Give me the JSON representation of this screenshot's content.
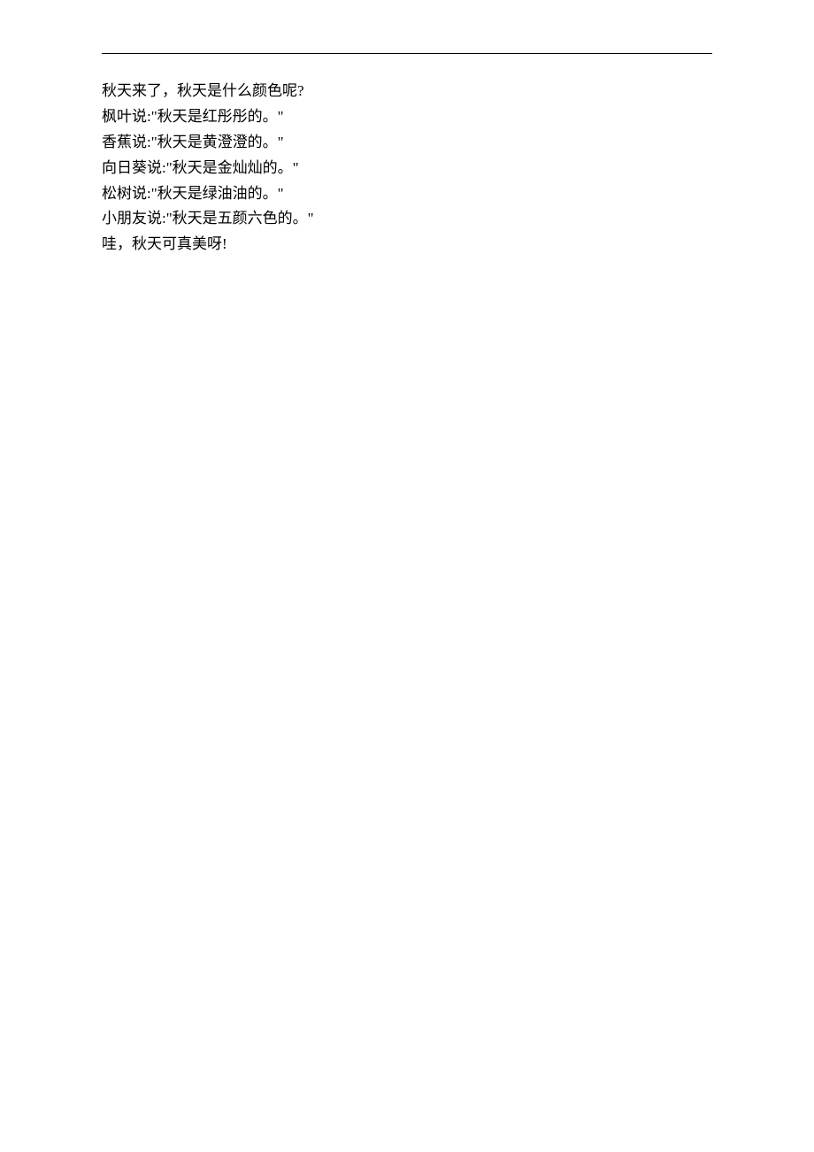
{
  "lines": [
    "秋天来了，秋天是什么颜色呢?",
    "枫叶说:\"秋天是红彤彤的。\"",
    "香蕉说:\"秋天是黄澄澄的。\"",
    "向日葵说:\"秋天是金灿灿的。\"",
    "松树说:\"秋天是绿油油的。\"",
    "小朋友说:\"秋天是五颜六色的。\"",
    "哇，秋天可真美呀!"
  ]
}
